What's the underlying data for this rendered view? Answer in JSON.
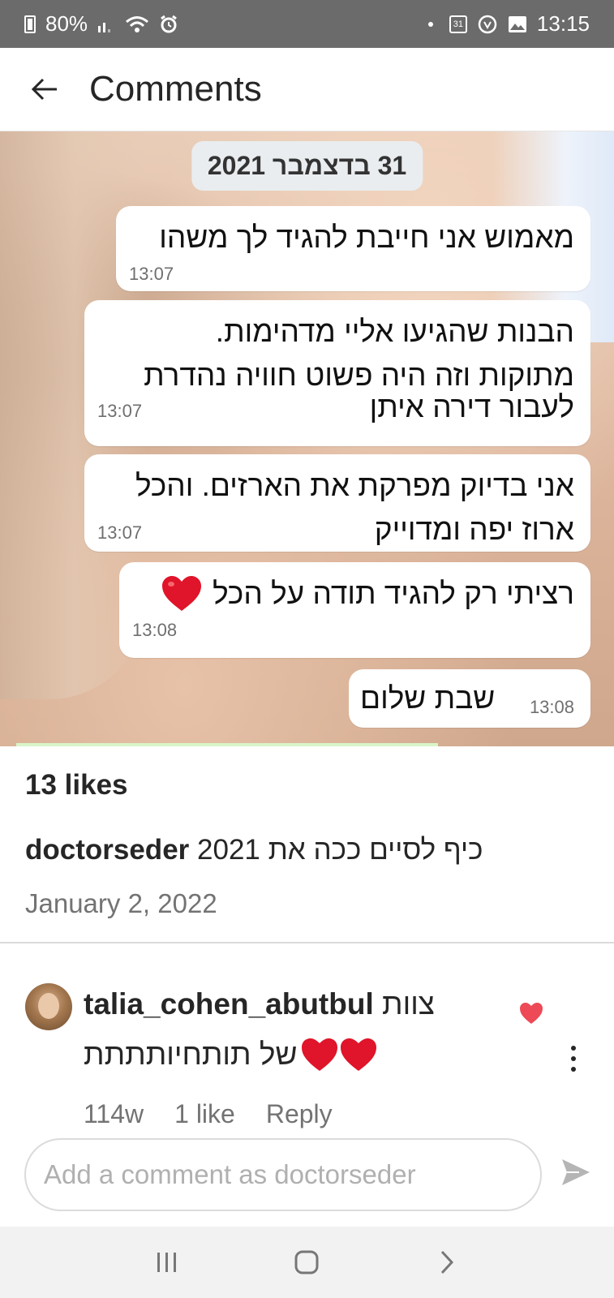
{
  "status_bar": {
    "battery": "80%",
    "time": "13:15",
    "calendar_day": "31",
    "icons": [
      "battery-icon",
      "signal-icon",
      "wifi-icon",
      "alarm-icon",
      "dot-icon",
      "calendar-icon",
      "whatsapp-icon",
      "gallery-icon"
    ]
  },
  "header": {
    "title": "Comments",
    "back_icon": "arrow-left-icon"
  },
  "post_image": {
    "date_chip": "31 בדצמבר 2021",
    "messages": [
      {
        "text": "מאמוש אני חייבת להגיד לך משהו",
        "time": "13:07"
      },
      {
        "text_lines": [
          "הבנות שהגיעו אליי מדהימות.",
          "מתוקות וזה היה פשוט חוויה נהדרת",
          "לעבור דירה איתן"
        ],
        "time": "13:07"
      },
      {
        "text_lines": [
          "אני בדיוק מפרקת את הארזים. והכל",
          "ארוז יפה ומדוייק"
        ],
        "time": "13:07"
      },
      {
        "text": "רציתי רק להגיד תודה על הכל",
        "time": "13:08",
        "emoji": "red-heart"
      },
      {
        "text": "שבת שלום",
        "time": "13:08"
      }
    ]
  },
  "post": {
    "likes": "13 likes",
    "username": "doctorseder",
    "caption": "כיף לסיים ככה את 2021",
    "date": "January 2, 2022"
  },
  "comment": {
    "username": "talia_cohen_abutbul",
    "text_part1": "צוות",
    "text_part2": "של תותחיותתתת",
    "emoji": "two-red-hearts",
    "age": "114w",
    "likes": "1 like",
    "reply": "Reply",
    "liked_color": "#ed4956"
  },
  "add_comment": {
    "placeholder": "Add a comment as doctorseder",
    "send_icon": "send-icon"
  },
  "nav_bar": {
    "icons": [
      "recent-apps-icon",
      "home-icon",
      "back-nav-icon"
    ]
  },
  "colors": {
    "status_bar_bg": "#6b6b6b",
    "text_primary": "#262626",
    "text_secondary": "#737373",
    "heart_red": "#ed4956",
    "nav_bg": "#f2f2f2"
  }
}
